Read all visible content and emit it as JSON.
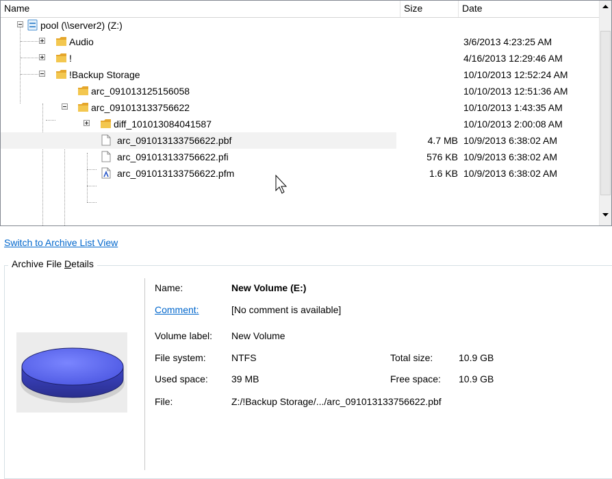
{
  "columns": {
    "name": "Name",
    "size": "Size",
    "date": "Date"
  },
  "tree": [
    {
      "label": "pool (\\\\server2) (Z:)",
      "size": "",
      "date": "",
      "icon": "network-drive-icon",
      "toggle": "minus"
    },
    {
      "label": "Audio",
      "size": "",
      "date": "3/6/2013 4:23:25 AM",
      "icon": "folder-icon",
      "toggle": "plus"
    },
    {
      "label": "!",
      "size": "",
      "date": "4/16/2013 12:29:46 AM",
      "icon": "folder-icon",
      "toggle": "plus"
    },
    {
      "label": "!Backup Storage",
      "size": "",
      "date": "10/10/2013 12:52:24 AM",
      "icon": "folder-icon",
      "toggle": "minus"
    },
    {
      "label": "arc_091013125156058",
      "size": "",
      "date": "10/10/2013 12:51:36 AM",
      "icon": "folder-icon",
      "toggle": "none"
    },
    {
      "label": "arc_091013133756622",
      "size": "",
      "date": "10/10/2013 1:43:35 AM",
      "icon": "folder-icon",
      "toggle": "minus"
    },
    {
      "label": "diff_101013084041587",
      "size": "",
      "date": "10/10/2013 2:00:08 AM",
      "icon": "folder-icon",
      "toggle": "plus"
    },
    {
      "label": "arc_091013133756622.pbf",
      "size": "4.7 MB",
      "date": "10/9/2013 6:38:02 AM",
      "icon": "file-icon",
      "toggle": "none"
    },
    {
      "label": "arc_091013133756622.pfi",
      "size": "576 KB",
      "date": "10/9/2013 6:38:02 AM",
      "icon": "file-icon",
      "toggle": "none"
    },
    {
      "label": "arc_091013133756622.pfm",
      "size": "1.6 KB",
      "date": "10/9/2013 6:38:02 AM",
      "icon": "font-file-icon",
      "toggle": "none"
    }
  ],
  "switch_link": "Switch to Archive List View",
  "details": {
    "legend_pre": "Archive File ",
    "legend_accel": "D",
    "legend_post": "etails",
    "name_label": "Name:",
    "name_value": "New Volume (E:)",
    "comment_label": "Comment:",
    "comment_value": "[No comment is available]",
    "volume_label_label": "Volume label:",
    "volume_label_value": "New Volume",
    "fs_label": "File system:",
    "fs_value": "NTFS",
    "total_label": "Total size:",
    "total_value": "10.9 GB",
    "used_label": "Used space:",
    "used_value": "39 MB",
    "free_label": "Free space:",
    "free_value": "10.9 GB",
    "file_label": "File:",
    "file_value": "Z:/!Backup Storage/.../arc_091013133756622.pbf"
  },
  "colors": {
    "link": "#0066cc",
    "folder": "#f3c74f",
    "disk": "#4a55e0"
  }
}
